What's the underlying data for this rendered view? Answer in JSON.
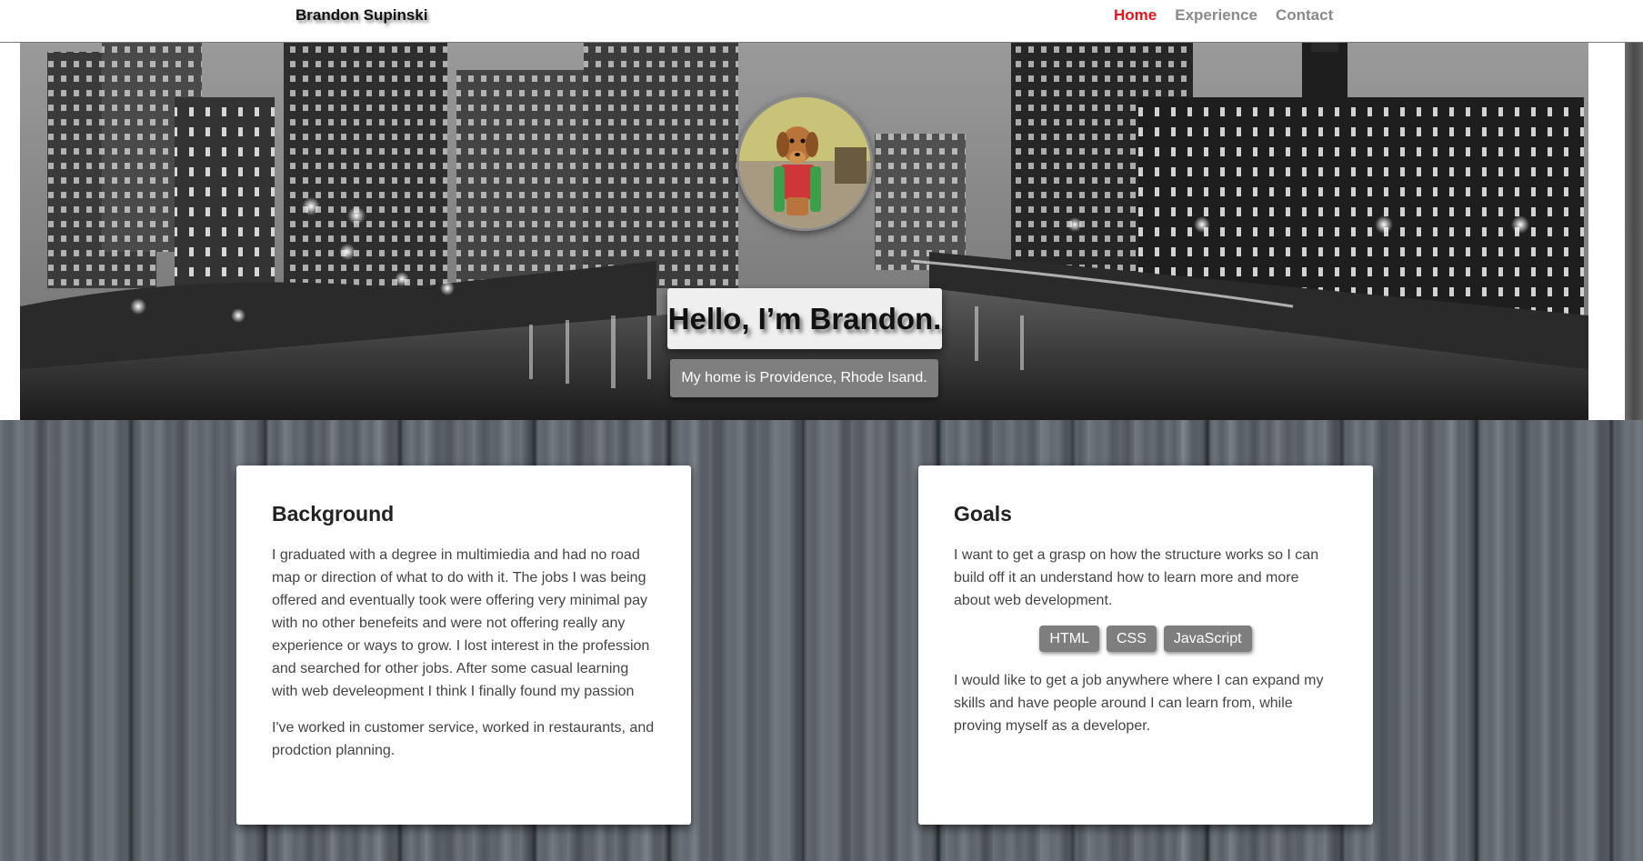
{
  "nav": {
    "brand": "Brandon Supinski",
    "links": [
      {
        "label": "Home",
        "active": true
      },
      {
        "label": "Experience",
        "active": false
      },
      {
        "label": "Contact",
        "active": false
      }
    ]
  },
  "hero": {
    "title": "Hello, I’m Brandon.",
    "subtitle": "My home is Providence, Rhode Isand."
  },
  "background_card": {
    "heading": "Background",
    "paragraphs": [
      "I graduated with a degree in multimiedia and had no road map or direction of what to do with it. The jobs I was being offered and eventually took were offering very minimal pay with no other benefeits and were not offering really any experience or ways to grow. I lost interest in the profession and searched for other jobs. After some casual learning with web develeopment I think I finally found my passion",
      "I've worked in customer service, worked in restaurants, and prodction planning."
    ]
  },
  "goals_card": {
    "heading": "Goals",
    "paragraphs": [
      "I want to get a grasp on how the structure works so I can build off it an understand how to learn more and more about web development.",
      "I would like to get a job anywhere where I can expand my skills and have people around I can learn from, while proving myself as a developer."
    ],
    "tags": [
      "HTML",
      "CSS",
      "JavaScript"
    ]
  },
  "colors": {
    "nav_active": "#e8141b",
    "nav_inactive": "#8a8a8a",
    "badge_bg": "#7e7e7e",
    "card_bg": "#ffffff"
  },
  "icons": {
    "avatar": "dog-photo-avatar"
  }
}
